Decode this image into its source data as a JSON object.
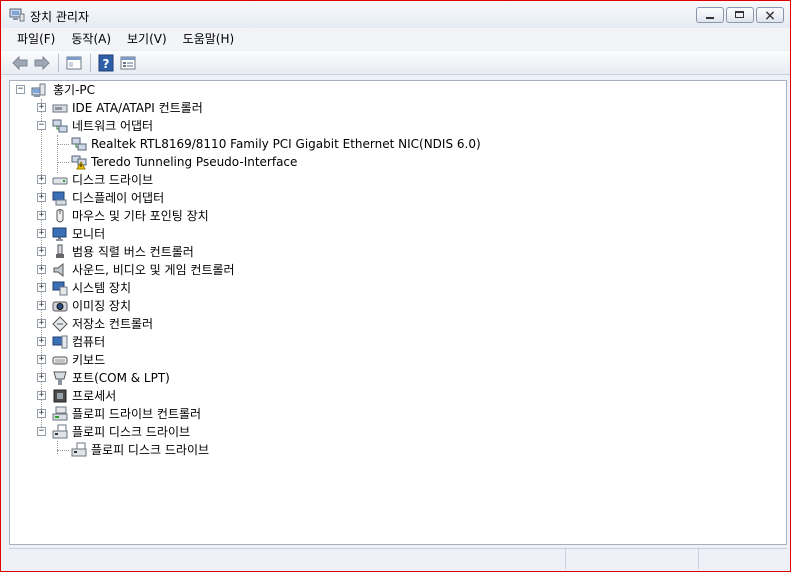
{
  "window": {
    "title": "장치 관리자",
    "border_color": "#e00000"
  },
  "menu": [
    {
      "label": "파일(F)"
    },
    {
      "label": "동작(A)"
    },
    {
      "label": "보기(V)"
    },
    {
      "label": "도움말(H)"
    }
  ],
  "toolbar": {
    "back_icon": "back-arrow-icon",
    "forward_icon": "forward-arrow-icon",
    "console_icon": "console-tree-icon",
    "help_icon": "help-icon",
    "properties_icon": "properties-icon"
  },
  "tree": {
    "root": {
      "label": "홍기-PC",
      "icon": "computer-icon",
      "expanded": true
    },
    "items": [
      {
        "label": "IDE ATA/ATAPI 컨트롤러",
        "icon": "ide-controller-icon",
        "expanded": false,
        "children": []
      },
      {
        "label": "네트워크 어댑터",
        "icon": "network-adapter-icon",
        "expanded": true,
        "children": [
          {
            "label": "Realtek RTL8169/8110 Family PCI Gigabit Ethernet NIC(NDIS 6.0)",
            "icon": "network-adapter-icon",
            "warning": false
          },
          {
            "label": "Teredo Tunneling Pseudo-Interface",
            "icon": "network-adapter-warning-icon",
            "warning": true
          }
        ]
      },
      {
        "label": "디스크 드라이브",
        "icon": "disk-drive-icon",
        "expanded": false,
        "children": []
      },
      {
        "label": "디스플레이 어댑터",
        "icon": "display-adapter-icon",
        "expanded": false,
        "children": []
      },
      {
        "label": "마우스 및 기타 포인팅 장치",
        "icon": "mouse-icon",
        "expanded": false,
        "children": []
      },
      {
        "label": "모니터",
        "icon": "monitor-icon",
        "expanded": false,
        "children": []
      },
      {
        "label": "범용 직렬 버스 컨트롤러",
        "icon": "usb-icon",
        "expanded": false,
        "children": []
      },
      {
        "label": "사운드, 비디오 및 게임 컨트롤러",
        "icon": "speaker-icon",
        "expanded": false,
        "children": []
      },
      {
        "label": "시스템 장치",
        "icon": "system-device-icon",
        "expanded": false,
        "children": []
      },
      {
        "label": "이미징 장치",
        "icon": "imaging-device-icon",
        "expanded": false,
        "children": []
      },
      {
        "label": "저장소 컨트롤러",
        "icon": "storage-controller-icon",
        "expanded": false,
        "children": []
      },
      {
        "label": "컴퓨터",
        "icon": "computer-icon",
        "expanded": false,
        "children": []
      },
      {
        "label": "키보드",
        "icon": "keyboard-icon",
        "expanded": false,
        "children": []
      },
      {
        "label": "포트(COM & LPT)",
        "icon": "port-icon",
        "expanded": false,
        "children": []
      },
      {
        "label": "프로세서",
        "icon": "processor-icon",
        "expanded": false,
        "children": []
      },
      {
        "label": "플로피 드라이브 컨트롤러",
        "icon": "floppy-controller-icon",
        "expanded": false,
        "children": []
      },
      {
        "label": "플로피 디스크 드라이브",
        "icon": "floppy-drive-icon",
        "expanded": true,
        "children": [
          {
            "label": "플로피 디스크 드라이브",
            "icon": "floppy-drive-icon",
            "warning": false
          }
        ]
      }
    ]
  },
  "colors": {
    "selection": "#3399ff",
    "warning": "#f2c200"
  }
}
